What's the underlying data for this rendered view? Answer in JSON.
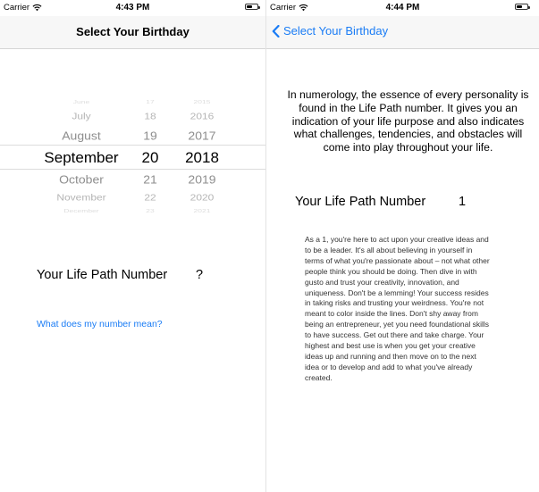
{
  "left_screen": {
    "status": {
      "carrier": "Carrier",
      "time": "4:43 PM"
    },
    "nav_title": "Select Your Birthday",
    "picker": {
      "months": [
        "June",
        "July",
        "August",
        "September",
        "October",
        "November",
        "December"
      ],
      "days": [
        "17",
        "18",
        "19",
        "20",
        "21",
        "22",
        "23"
      ],
      "years": [
        "2015",
        "2016",
        "2017",
        "2018",
        "2019",
        "2020",
        "2021"
      ],
      "selected": {
        "month": "September",
        "day": "20",
        "year": "2018"
      }
    },
    "life_path_label": "Your Life Path Number",
    "life_path_value": "?",
    "meaning_link": "What does my number mean?"
  },
  "right_screen": {
    "status": {
      "carrier": "Carrier",
      "time": "4:44 PM"
    },
    "back_label": "Select Your Birthday",
    "intro": "In numerology, the essence of every personality is found in the Life Path number. It gives you an indication of your life purpose and also indicates what challenges, tendencies, and obstacles will come into play throughout your life.",
    "life_path_label": "Your Life Path Number",
    "life_path_value": "1",
    "description": "As a 1, you're here to act upon your creative ideas and to be a leader. It's all about believing in yourself in terms of what you're passionate about – not what other people think you should be doing. Then dive in with gusto and trust your creativity, innovation, and uniqueness. Don't be a lemming! Your success resides in taking risks and trusting your weirdness. You're not meant to color inside the lines. Don't shy away from being an entrepreneur, yet you need foundational skills to have success. Get out there and take charge. Your highest and best use is when you get your creative ideas up and running and then move on to the next idea or to develop and add to what you've already created."
  },
  "colors": {
    "accent": "#1a7cf5",
    "nav_background": "#f7f7f7",
    "picker_faded": "#b4b4b4"
  }
}
